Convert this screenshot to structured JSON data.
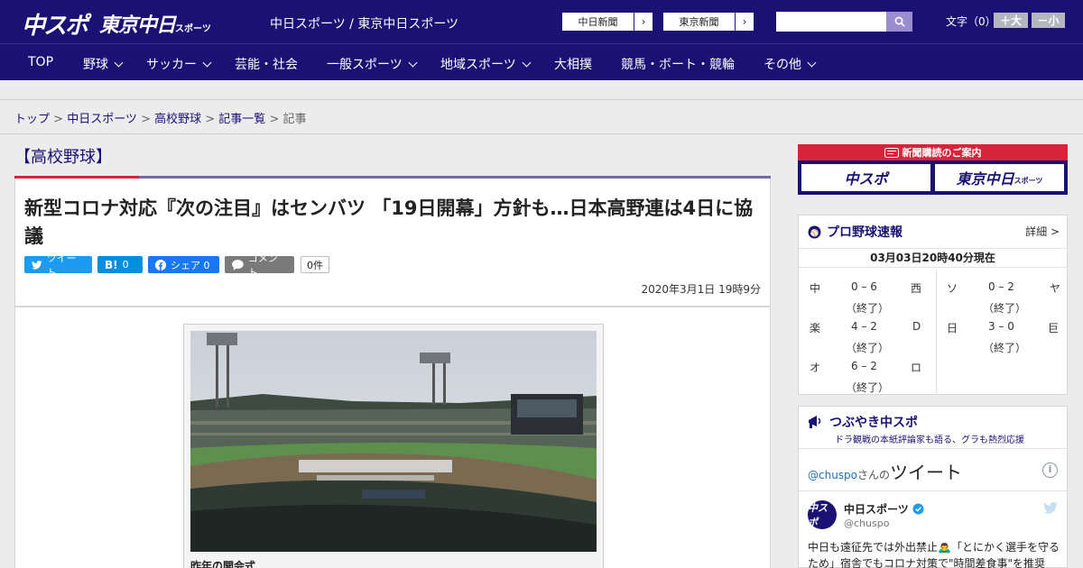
{
  "header": {
    "logo_chuspo": "中スポ",
    "logo_tokyo": "東京中日",
    "logo_tokyo_small": "スポーツ",
    "site_name": "中日スポーツ / 東京中日スポーツ",
    "ext_links": [
      "中日新聞",
      "東京新聞"
    ],
    "font_label": "文字（0）",
    "font_large": "＋大",
    "font_small": "－小"
  },
  "nav": {
    "items": [
      "TOP",
      "野球",
      "サッカー",
      "芸能・社会",
      "一般スポーツ",
      "地域スポーツ",
      "大相撲",
      "競馬・ボート・競輪",
      "その他"
    ]
  },
  "breadcrumb": {
    "items": [
      "トップ",
      "中日スポーツ",
      "高校野球",
      "記事一覧"
    ],
    "current": "記事"
  },
  "article": {
    "category": "【高校野球】",
    "headline": "新型コロナ対応『次の注目』はセンバツ 「19日開幕」方針も…日本高野連は4日に協議",
    "share": {
      "tweet": "ツイート",
      "hatena_count": "0",
      "facebook": "シェア 0",
      "comment": "コメント",
      "comment_count": "0件"
    },
    "date": "2020年3月1日 19時9分",
    "photo_caption": "昨年の開会式"
  },
  "sidebar": {
    "subscribe": {
      "title": "新聞購読のご案内",
      "chuspo": "中スポ",
      "tokyo": "東京中日",
      "tokyo_small": "スポーツ"
    },
    "scores": {
      "title": "プロ野球速報",
      "detail": "詳細 >",
      "as_of": "03月03日20時40分現在",
      "games": [
        {
          "home": "中",
          "score": "0 – 6",
          "away": "西",
          "status": "（終了）"
        },
        {
          "home": "ソ",
          "score": "0 – 2",
          "away": "ヤ",
          "status": "（終了）"
        },
        {
          "home": "楽",
          "score": "4 – 2",
          "away": "D",
          "status": "（終了）"
        },
        {
          "home": "日",
          "score": "3 – 0",
          "away": "巨",
          "status": "（終了）"
        },
        {
          "home": "オ",
          "score": "6 – 2",
          "away": "ロ",
          "status": "（終了）"
        }
      ]
    },
    "twitter": {
      "title": "つぶやき中スポ",
      "subtitle": "ドラ観戦の本紙評論家も語る、グラも熱烈応援",
      "handle": "@chuspo",
      "handle_suffix": "さんの",
      "tweets_label": "ツイート",
      "user_name": "中日スポーツ",
      "user_id": "@chuspo",
      "avatar_text": "中スポ",
      "tweet_text": "中日も遠征先では外出禁止🙇‍♂️「とにかく選手を守るため」宿舎でもコロナ対策で\"時間差食事\"を推奨"
    }
  }
}
